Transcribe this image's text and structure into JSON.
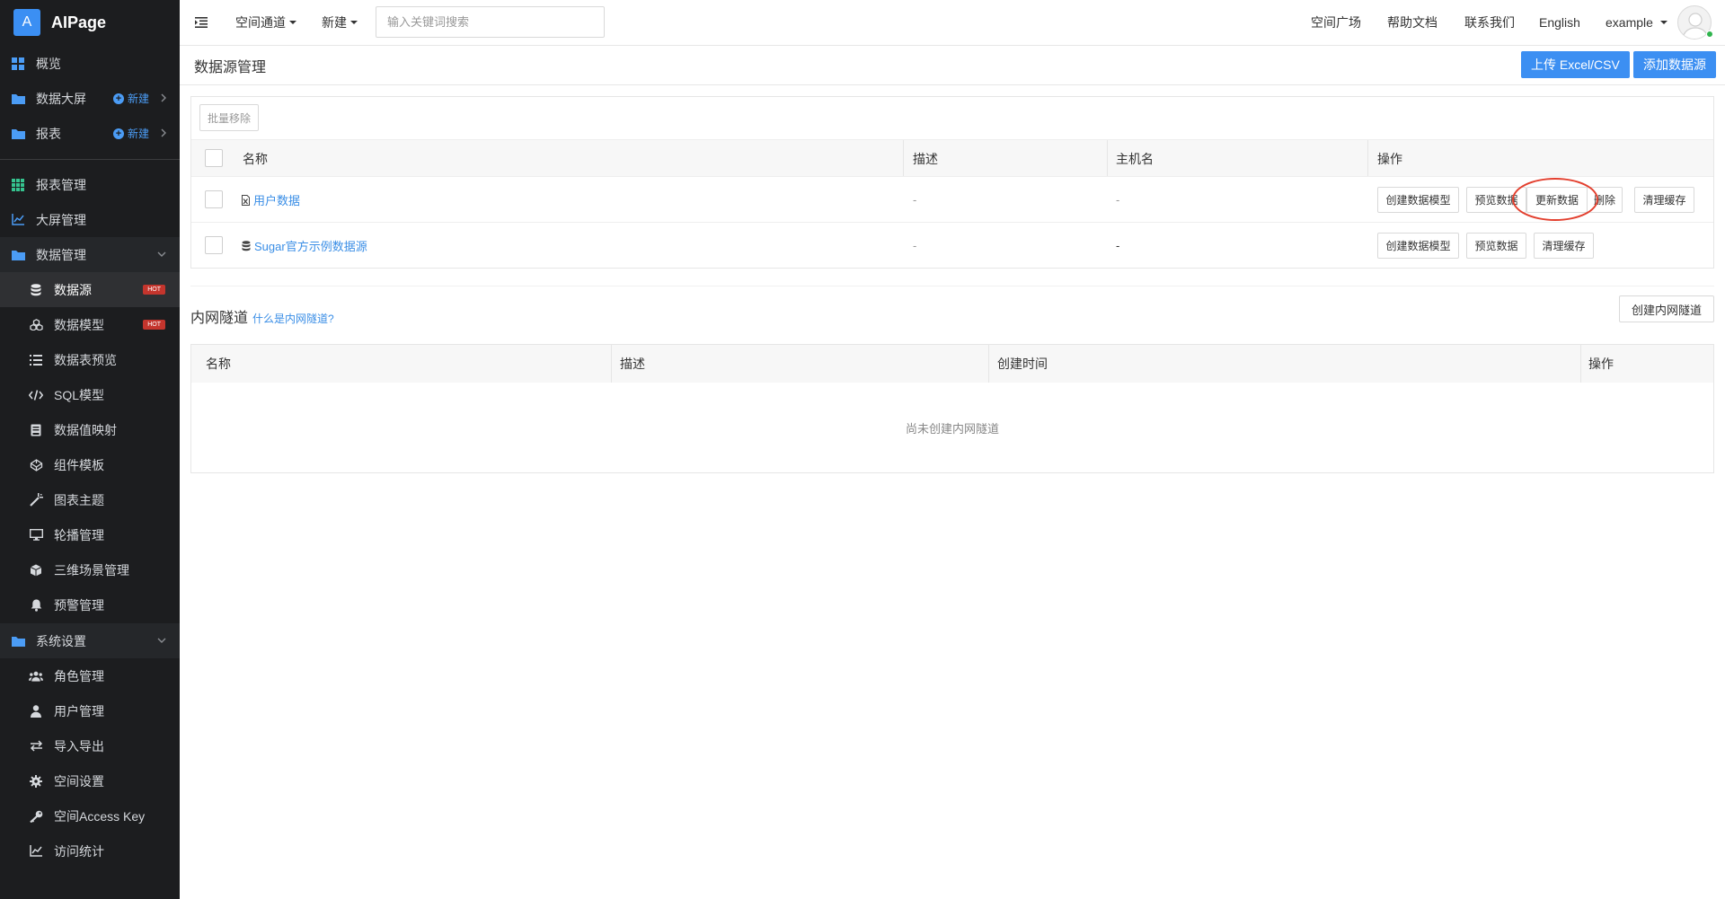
{
  "brand": {
    "initial": "A",
    "name": "AIPage"
  },
  "sidebar": {
    "top_items": [
      {
        "label": "概览"
      },
      {
        "label": "数据大屏",
        "new_label": "新建"
      },
      {
        "label": "报表",
        "new_label": "新建"
      }
    ],
    "items": [
      {
        "label": "报表管理"
      },
      {
        "label": "大屏管理"
      },
      {
        "label": "数据管理"
      },
      {
        "label": "数据源",
        "badge": "HOT"
      },
      {
        "label": "数据模型",
        "badge": "HOT"
      },
      {
        "label": "数据表预览"
      },
      {
        "label": "SQL模型"
      },
      {
        "label": "数据值映射"
      },
      {
        "label": "组件模板"
      },
      {
        "label": "图表主题"
      },
      {
        "label": "轮播管理"
      },
      {
        "label": "三维场景管理"
      },
      {
        "label": "预警管理"
      },
      {
        "label": "系统设置"
      },
      {
        "label": "角色管理"
      },
      {
        "label": "用户管理"
      },
      {
        "label": "导入导出"
      },
      {
        "label": "空间设置"
      },
      {
        "label": "空间Access Key"
      },
      {
        "label": "访问统计"
      }
    ]
  },
  "topbar": {
    "space_channel": "空间通道",
    "new_menu": "新建",
    "search_placeholder": "输入关键词搜索",
    "plaza": "空间广场",
    "help": "帮助文档",
    "contact": "联系我们",
    "language": "English",
    "user": "example"
  },
  "page": {
    "title": "数据源管理",
    "upload_btn": "上传 Excel/CSV",
    "add_btn": "添加数据源"
  },
  "datasource": {
    "bulk_remove": "批量移除",
    "columns": [
      "名称",
      "描述",
      "主机名",
      "操作"
    ],
    "rows": [
      {
        "name": "用户数据",
        "desc": "-",
        "host": "-",
        "actions": [
          "创建数据模型",
          "预览数据",
          "更新数据",
          "删除",
          "清理缓存"
        ]
      },
      {
        "name": "Sugar官方示例数据源",
        "desc": "-",
        "host": "-",
        "actions": [
          "创建数据模型",
          "预览数据",
          "清理缓存"
        ]
      }
    ]
  },
  "tunnel": {
    "title": "内网隧道",
    "help_link": "什么是内网隧道?",
    "create_btn": "创建内网隧道",
    "columns": [
      "名称",
      "描述",
      "创建时间",
      "操作"
    ],
    "empty": "尚未创建内网隧道"
  },
  "colors": {
    "sidebar_bg": "#1c1d1f",
    "primary": "#3c8ff2",
    "link": "#3a8ee6",
    "hot": "#c4352d",
    "highlight": "#e33f2e"
  }
}
